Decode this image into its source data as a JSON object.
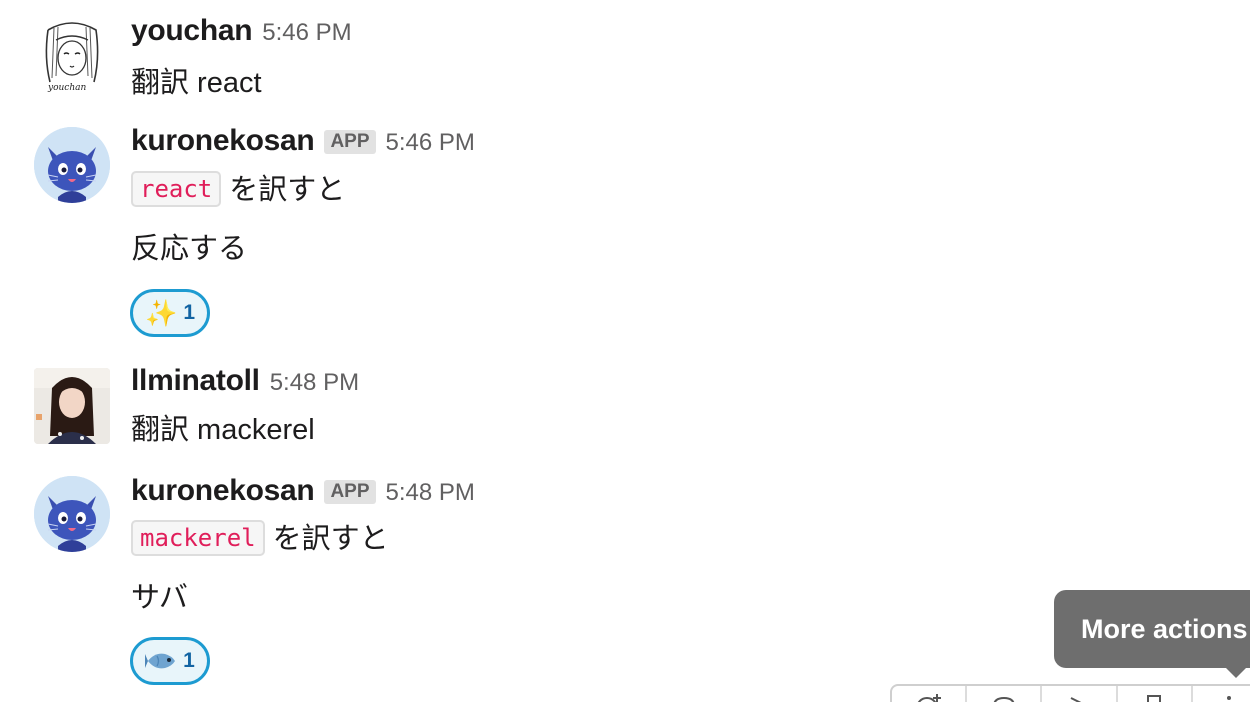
{
  "messages": [
    {
      "username": "youchan",
      "time": "5:46 PM",
      "text": "翻訳 react",
      "avatar_icon": "sketch-portrait-avatar",
      "avatar_signature": "youchan"
    },
    {
      "username": "kuronekosan",
      "badge": "APP",
      "time": "5:46 PM",
      "code": "react",
      "code_suffix": "を訳すと",
      "result": "反応する",
      "reaction": {
        "emoji": "✨",
        "emoji_name": "sparkles-emoji",
        "count": "1"
      },
      "avatar_icon": "blue-cat-avatar"
    },
    {
      "username": "llminatoll",
      "time": "5:48 PM",
      "text": "翻訳 mackerel",
      "avatar_icon": "photo-avatar"
    },
    {
      "username": "kuronekosan",
      "badge": "APP",
      "time": "5:48 PM",
      "code": "mackerel",
      "code_suffix": "を訳すと",
      "result": "サバ",
      "reaction": {
        "emoji": "fish",
        "emoji_name": "fish-emoji",
        "count": "1"
      },
      "avatar_icon": "blue-cat-avatar"
    }
  ],
  "tooltip": {
    "text": "More actions"
  },
  "message_actions": [
    "add-reaction-icon",
    "reply-in-thread-icon",
    "share-message-icon",
    "save-message-icon",
    "more-actions-icon"
  ],
  "colors": {
    "code_text": "#e01e5a",
    "reaction_border": "#1d9bd1",
    "reaction_bg": "#e8f5fa",
    "reaction_count": "#1264a3",
    "tooltip_bg": "#6e6e6e"
  }
}
